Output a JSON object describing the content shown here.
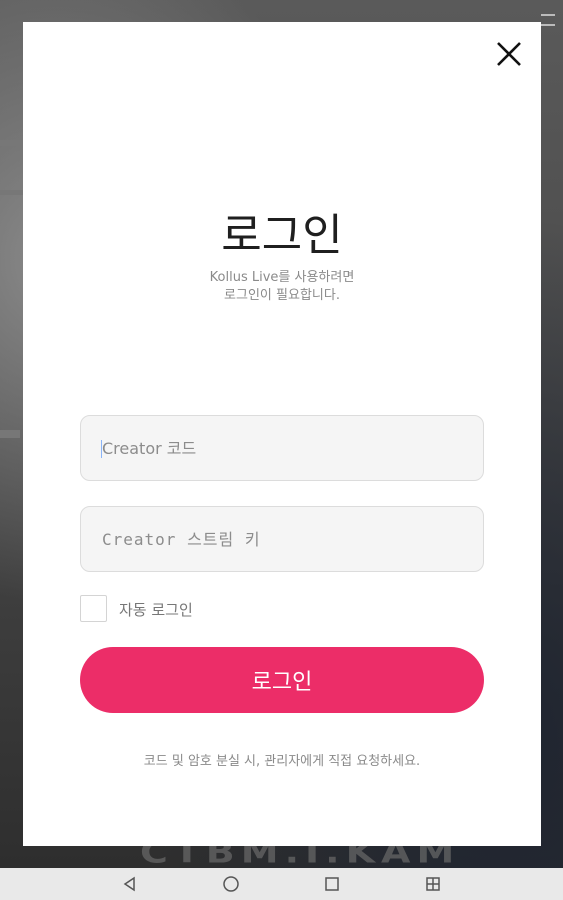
{
  "modal": {
    "title": "로그인",
    "subtitle_line1": "Kollus Live를 사용하려면",
    "subtitle_line2": "로그인이 필요합니다.",
    "code_input": {
      "placeholder": "Creator 코드",
      "value": ""
    },
    "key_input": {
      "placeholder": "Creator 스트림 키",
      "value": ""
    },
    "auto_login": {
      "label": "자동 로그인",
      "checked": false
    },
    "login_button": "로그인",
    "help_text": "코드 및 암호 분실 시, 관리자에게 직접 요청하세요.",
    "accent_color": "#ec2d68"
  },
  "background": {
    "overlay_text": "CTBM.I.KAM"
  },
  "navbar": {
    "icons": [
      "back-icon",
      "home-icon",
      "recents-icon",
      "screen-icon"
    ]
  }
}
